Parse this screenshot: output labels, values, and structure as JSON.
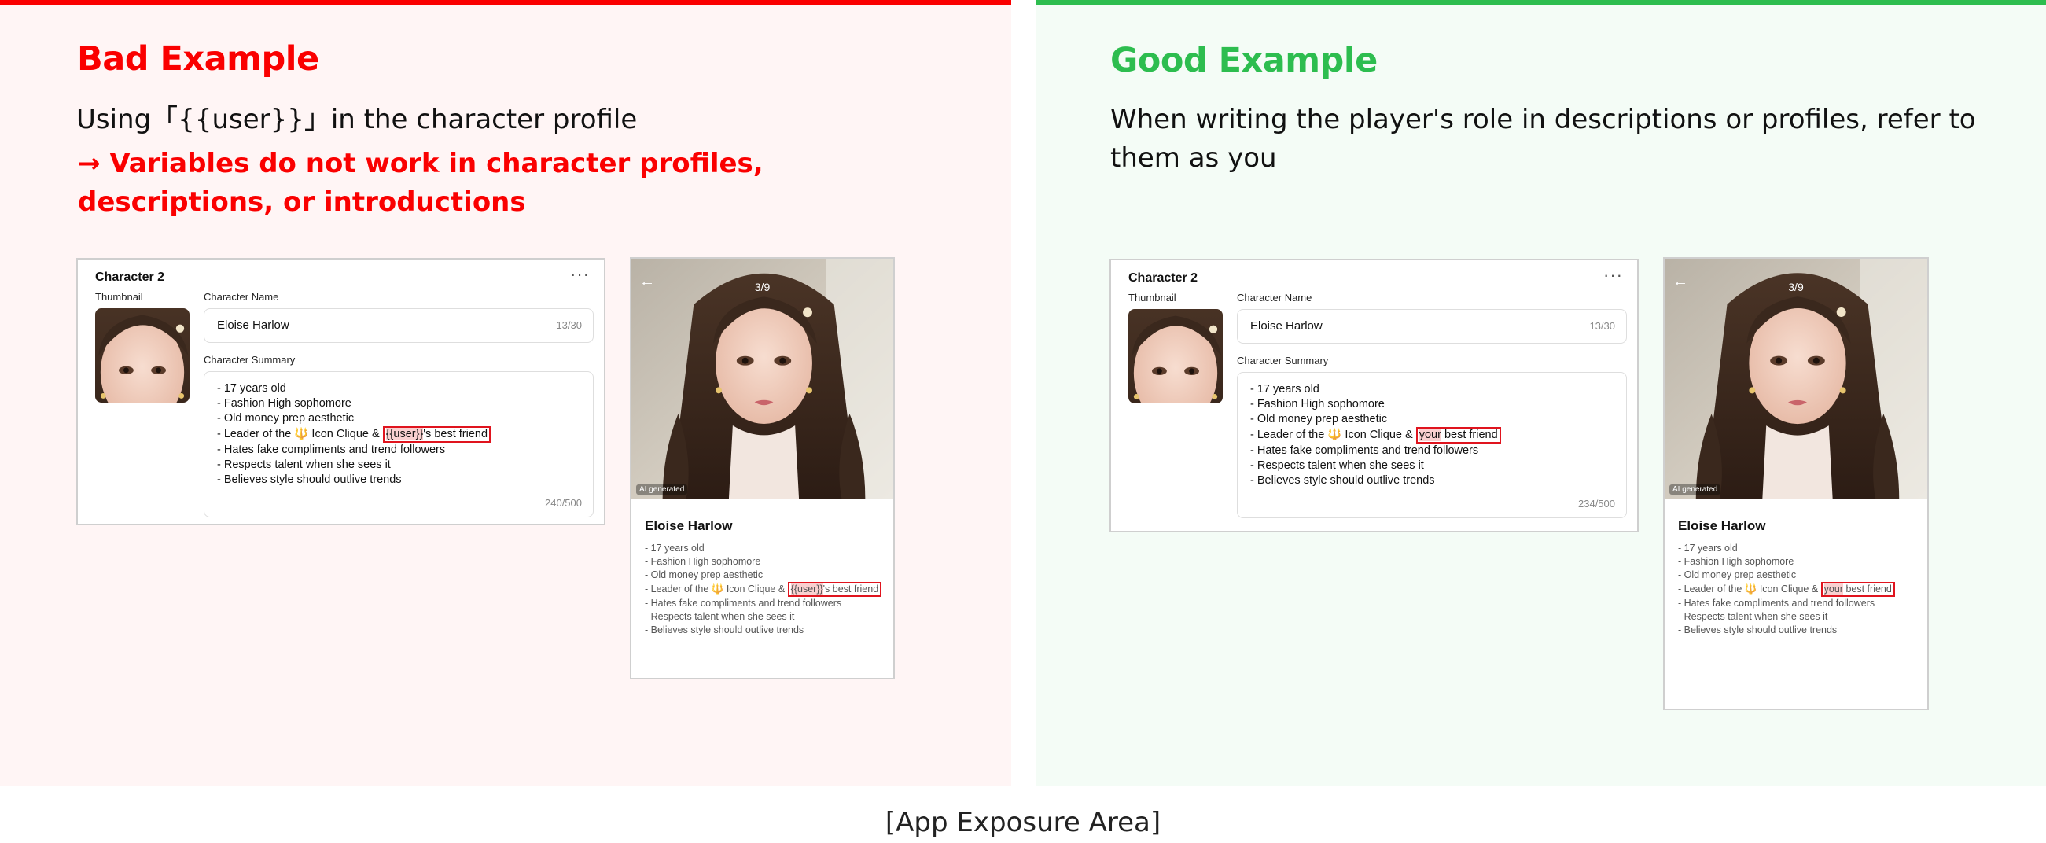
{
  "bad": {
    "heading": "Bad Example",
    "subheading": "Using「{{user}}」in the character profile",
    "warning": "→ Variables do not work in character profiles, descriptions, or introductions",
    "form": {
      "title": "Character 2",
      "thumbnail_label": "Thumbnail",
      "name_label": "Character Name",
      "name_value": "Eloise Harlow",
      "name_count": "13/30",
      "summary_label": "Character Summary",
      "summary_lines": [
        "- 17 years old",
        "- Fashion High sophomore",
        "- Old money prep aesthetic",
        "- Leader of the 🔱 Icon Clique &",
        "- Hates fake compliments and trend followers",
        "- Respects talent when she sees it",
        "- Believes style should outlive trends"
      ],
      "highlight_var": "{{user}}",
      "highlight_rest": "'s best friend",
      "summary_count": "240/500"
    },
    "preview": {
      "page_counter": "3/9",
      "ai_badge": "AI generated",
      "name": "Eloise Harlow",
      "lines": [
        "- 17 years old",
        "- Fashion High sophomore",
        "- Old money prep aesthetic",
        "- Leader of the 🔱 Icon Clique &",
        "- Hates fake compliments and trend followers",
        "- Respects talent when she sees it",
        "- Believes style should outlive trends"
      ],
      "highlight_var": "{{user}}",
      "highlight_rest": "'s best friend"
    }
  },
  "good": {
    "heading": "Good Example",
    "subheading": "When writing the player's role in descriptions or profiles, refer to them as you",
    "form": {
      "title": "Character 2",
      "thumbnail_label": "Thumbnail",
      "name_label": "Character Name",
      "name_value": "Eloise Harlow",
      "name_count": "13/30",
      "summary_label": "Character Summary",
      "summary_lines": [
        "- 17 years old",
        "- Fashion High sophomore",
        "- Old money prep aesthetic",
        "- Leader of the 🔱 Icon Clique &",
        "- Hates fake compliments and trend followers",
        "- Respects talent when she sees it",
        "- Believes style should outlive trends"
      ],
      "highlight_var": "your",
      "highlight_rest": " best friend",
      "summary_count": "234/500"
    },
    "preview": {
      "page_counter": "3/9",
      "ai_badge": "AI generated",
      "name": "Eloise Harlow",
      "lines": [
        "- 17 years old",
        "- Fashion High sophomore",
        "- Old money prep aesthetic",
        "- Leader of the 🔱 Icon Clique &",
        "- Hates fake compliments and trend followers",
        "- Respects talent when she sees it",
        "- Believes style should outlive trends"
      ],
      "highlight_var": "your",
      "highlight_rest": " best friend"
    }
  },
  "caption": "[App Exposure Area]",
  "colors": {
    "bad_accent": "#fa0000",
    "good_accent": "#2dbd4f",
    "highlight_border": "#e0141e",
    "highlight_fill": "#f9d0d0"
  }
}
